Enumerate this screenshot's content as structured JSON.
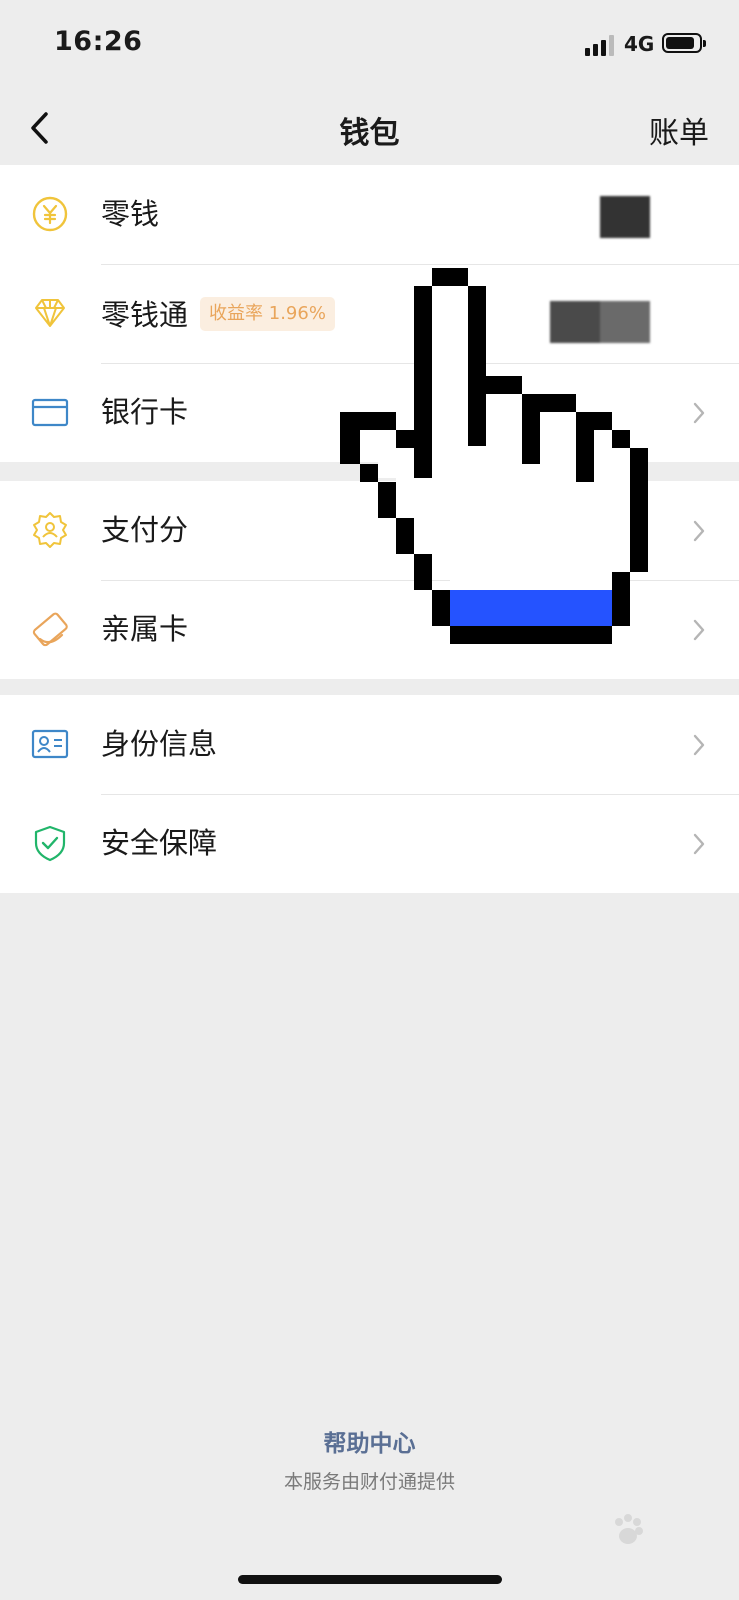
{
  "status_bar": {
    "time": "16:26",
    "network": "4G"
  },
  "nav": {
    "title": "钱包",
    "right_label": "账单"
  },
  "groups": [
    {
      "items": [
        {
          "label": "零钱",
          "icon": "yuan-coin-icon"
        },
        {
          "label": "零钱通",
          "icon": "diamond-icon",
          "badge": "收益率 1.96%"
        },
        {
          "label": "银行卡",
          "icon": "bank-card-icon"
        }
      ]
    },
    {
      "items": [
        {
          "label": "支付分",
          "icon": "badge-user-icon"
        },
        {
          "label": "亲属卡",
          "icon": "family-card-icon"
        }
      ]
    },
    {
      "items": [
        {
          "label": "身份信息",
          "icon": "id-card-icon"
        },
        {
          "label": "安全保障",
          "icon": "shield-check-icon"
        }
      ]
    }
  ],
  "footer": {
    "help_center": "帮助中心",
    "provider": "本服务由财付通提供"
  },
  "colors": {
    "accent_yellow": "#f0c43b",
    "accent_blue": "#3e87c8",
    "accent_orange": "#e9a55b",
    "accent_green": "#21b56a",
    "link": "#5a6f94",
    "cursor_blue": "#2553ff"
  }
}
